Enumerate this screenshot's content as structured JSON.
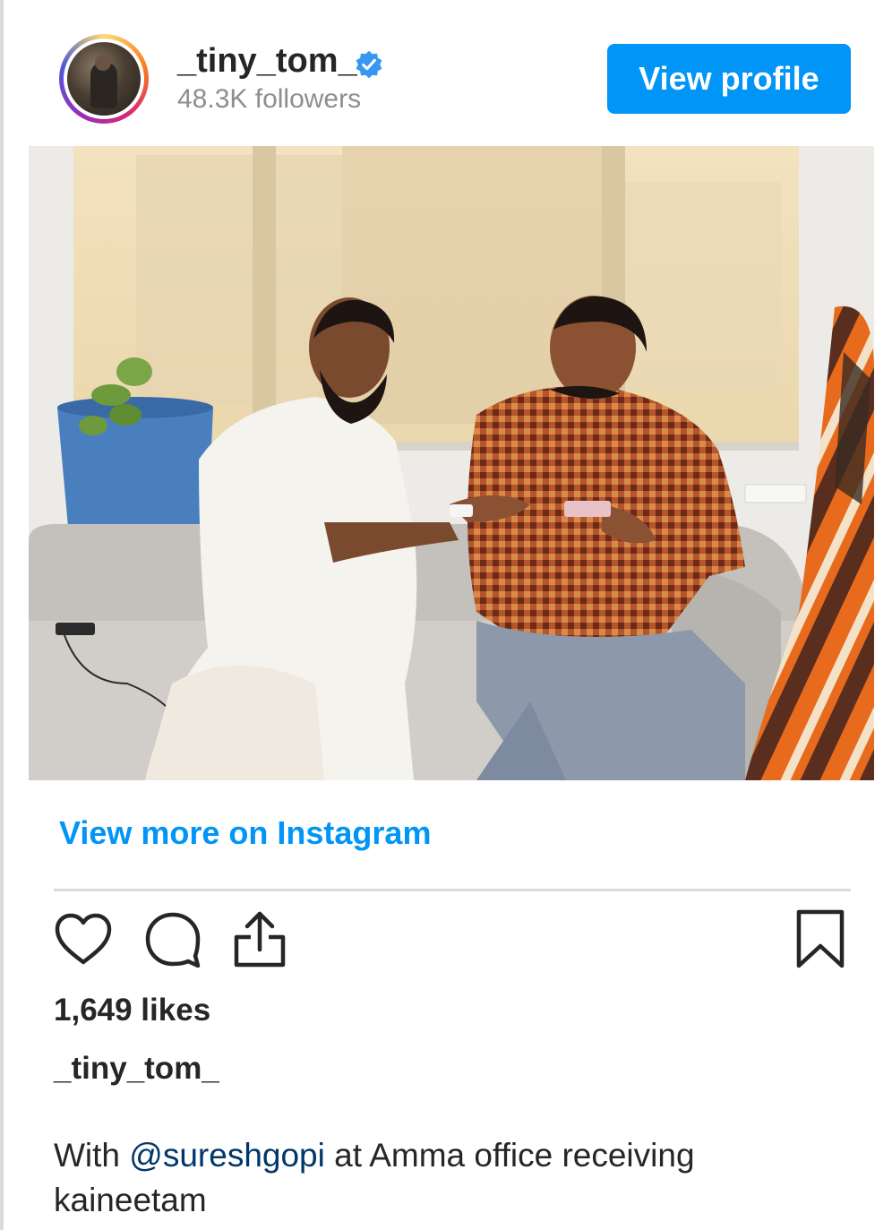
{
  "post": {
    "username": "_tiny_tom_",
    "followers": "48.3K followers",
    "view_profile_label": "View profile",
    "view_more_label": "View more on Instagram",
    "likes": "1,649 likes",
    "caption_username": "_tiny_tom_",
    "caption": {
      "before": "With ",
      "mention": "@sureshgopi",
      "after": " at Amma office receiving kaineetam"
    }
  },
  "icons": {
    "verified": "verified-badge-icon",
    "like": "heart-icon",
    "comment": "comment-icon",
    "share": "share-icon",
    "save": "bookmark-icon"
  },
  "colors": {
    "accent": "#0095f6",
    "mention": "#00376b",
    "text": "#262626",
    "muted": "#8e8e8e",
    "divider": "#dbdbdb"
  }
}
